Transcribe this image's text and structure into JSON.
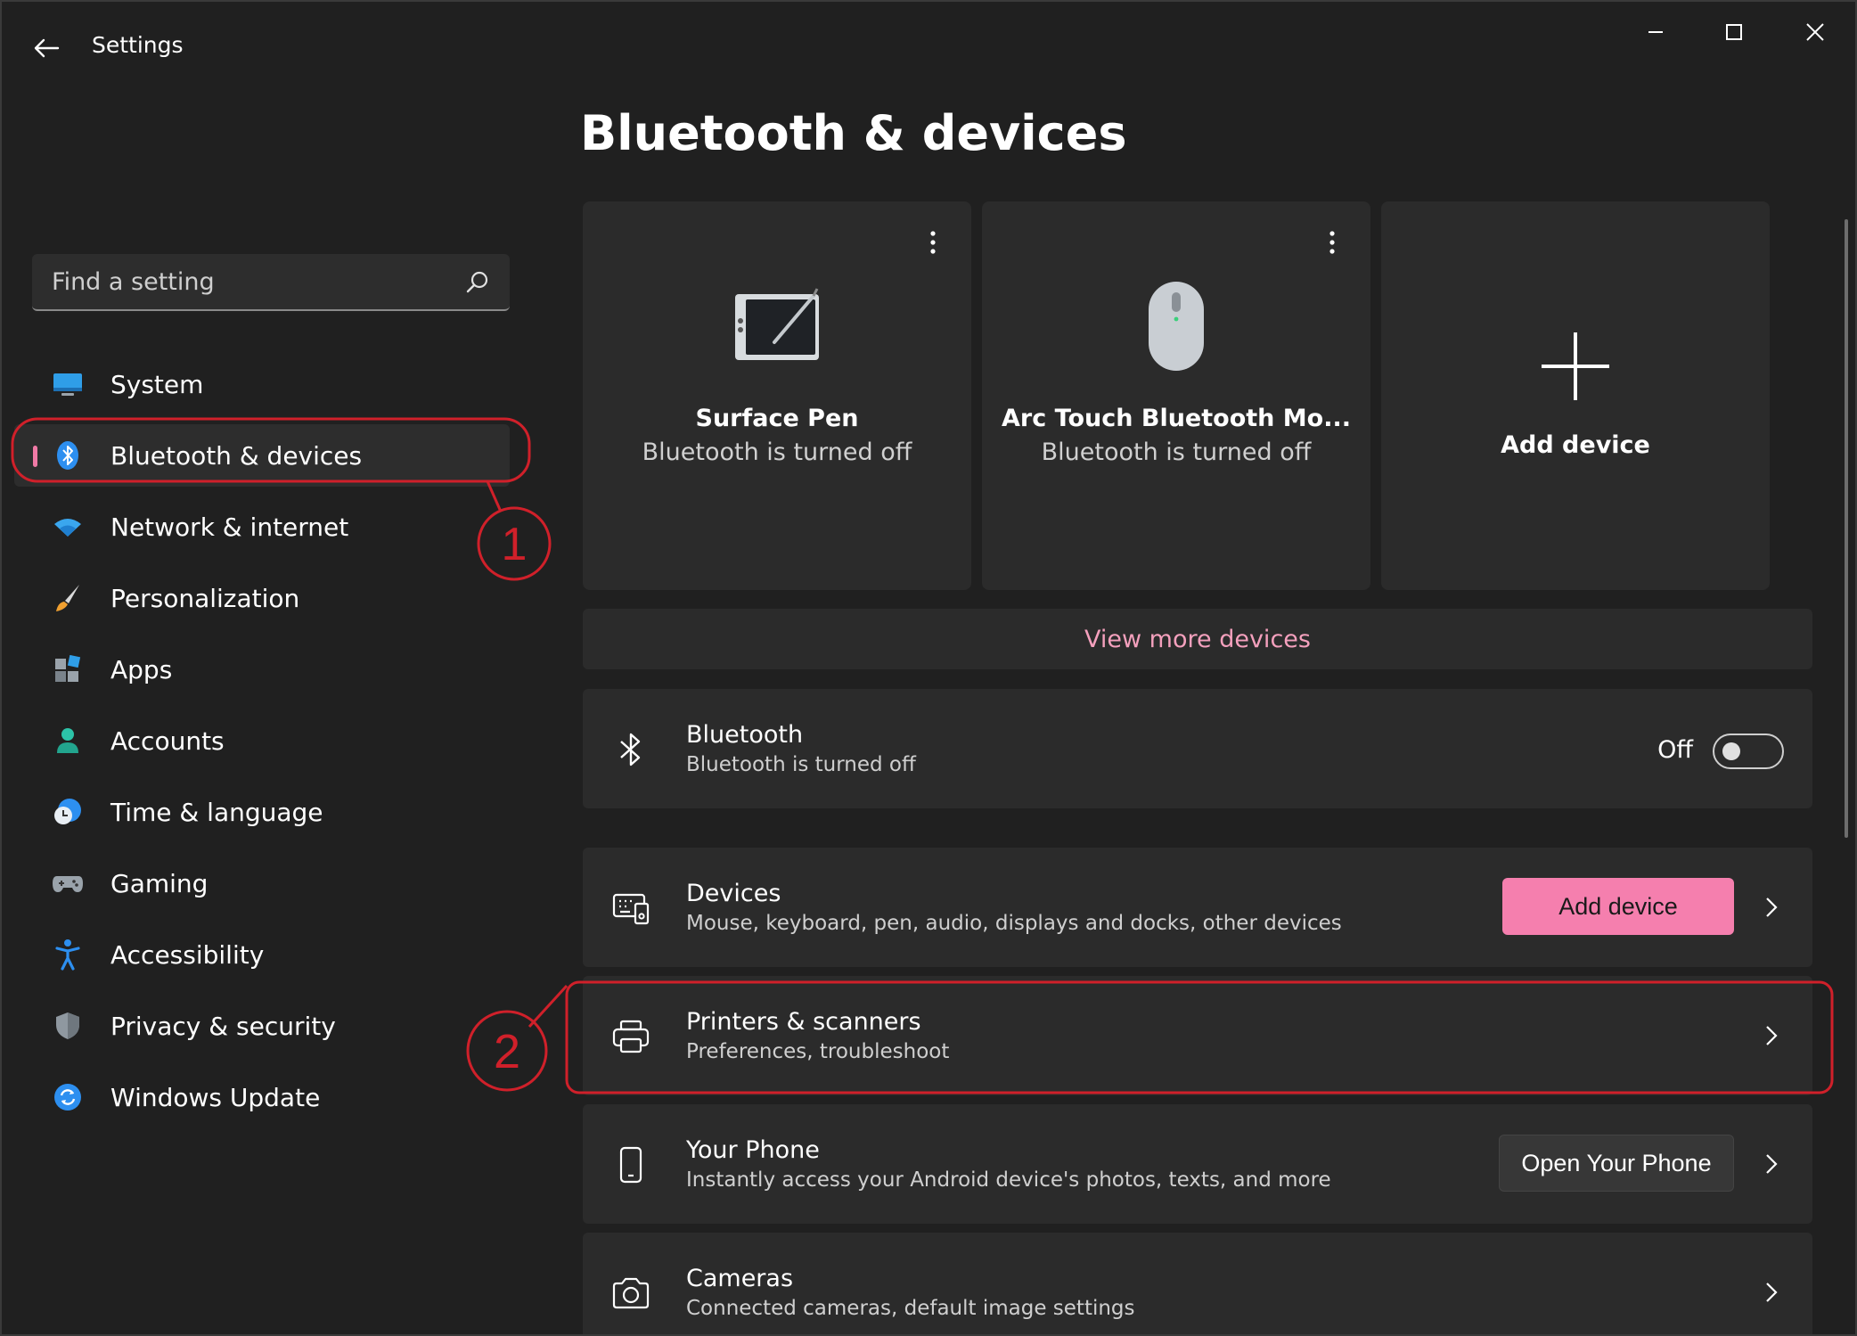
{
  "window": {
    "title": "Settings"
  },
  "sidebar": {
    "search": {
      "placeholder": "Find a setting"
    },
    "items": [
      {
        "label": "System",
        "icon": "system-icon",
        "active": false
      },
      {
        "label": "Bluetooth & devices",
        "icon": "bluetooth-icon",
        "active": true
      },
      {
        "label": "Network & internet",
        "icon": "wifi-icon",
        "active": false
      },
      {
        "label": "Personalization",
        "icon": "paintbrush-icon",
        "active": false
      },
      {
        "label": "Apps",
        "icon": "apps-icon",
        "active": false
      },
      {
        "label": "Accounts",
        "icon": "account-icon",
        "active": false
      },
      {
        "label": "Time & language",
        "icon": "globe-clock-icon",
        "active": false
      },
      {
        "label": "Gaming",
        "icon": "gamepad-icon",
        "active": false
      },
      {
        "label": "Accessibility",
        "icon": "accessibility-icon",
        "active": false
      },
      {
        "label": "Privacy & security",
        "icon": "shield-icon",
        "active": false
      },
      {
        "label": "Windows Update",
        "icon": "update-icon",
        "active": false
      }
    ]
  },
  "main": {
    "title": "Bluetooth & devices",
    "device_cards": [
      {
        "name": "Surface Pen",
        "status": "Bluetooth is turned off",
        "icon": "pen-tablet-icon"
      },
      {
        "name": "Arc Touch Bluetooth Mo...",
        "status": "Bluetooth is turned off",
        "icon": "mouse-icon"
      }
    ],
    "add_card": {
      "label": "Add device"
    },
    "view_more": "View more devices",
    "bluetooth_row": {
      "title": "Bluetooth",
      "subtitle": "Bluetooth is turned off",
      "toggle_label": "Off",
      "toggle_on": false
    },
    "rows": [
      {
        "title": "Devices",
        "subtitle": "Mouse, keyboard, pen, audio, displays and docks, other devices",
        "button": "Add device"
      },
      {
        "title": "Printers & scanners",
        "subtitle": "Preferences, troubleshoot"
      },
      {
        "title": "Your Phone",
        "subtitle": "Instantly access your Android device's photos, texts, and more",
        "button": "Open Your Phone"
      },
      {
        "title": "Cameras",
        "subtitle": "Connected cameras, default image settings"
      }
    ]
  },
  "annotations": [
    {
      "number": "1"
    },
    {
      "number": "2"
    }
  ],
  "colors": {
    "accent": "#f57fae",
    "link": "#f4a0bd",
    "annotation": "#d0202a",
    "background": "#202020",
    "card": "#2b2b2b"
  }
}
